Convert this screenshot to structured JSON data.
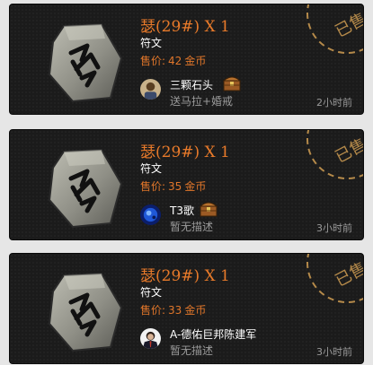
{
  "listings": [
    {
      "title": "瑟(29#) X 1",
      "item_type": "符文",
      "price_label": "售价:",
      "price_value": "42",
      "price_unit": "金币",
      "seller": "三颗石头",
      "description": "送马拉+婚戒",
      "time": "2小时前",
      "sold_stamp": "已售",
      "avatar_icon": "person-avatar-icon",
      "has_chest": true
    },
    {
      "title": "瑟(29#) X 1",
      "item_type": "符文",
      "price_label": "售价:",
      "price_value": "35",
      "price_unit": "金币",
      "seller": "T3歌",
      "description": "暂无描述",
      "time": "3小时前",
      "sold_stamp": "已售",
      "avatar_icon": "blue-avatar-icon",
      "has_chest": true
    },
    {
      "title": "瑟(29#) X 1",
      "item_type": "符文",
      "price_label": "售价:",
      "price_value": "33",
      "price_unit": "金币",
      "seller": "A-德佑巨邦陈建军",
      "description": "暂无描述",
      "time": "3小时前",
      "sold_stamp": "已售",
      "avatar_icon": "suit-avatar-icon",
      "has_chest": false
    }
  ],
  "colors": {
    "card_bg": "#1b1b1b",
    "title": "#e87a2a",
    "price": "#e0762a",
    "stamp": "#b58a4a",
    "muted": "#9a9a9a"
  }
}
